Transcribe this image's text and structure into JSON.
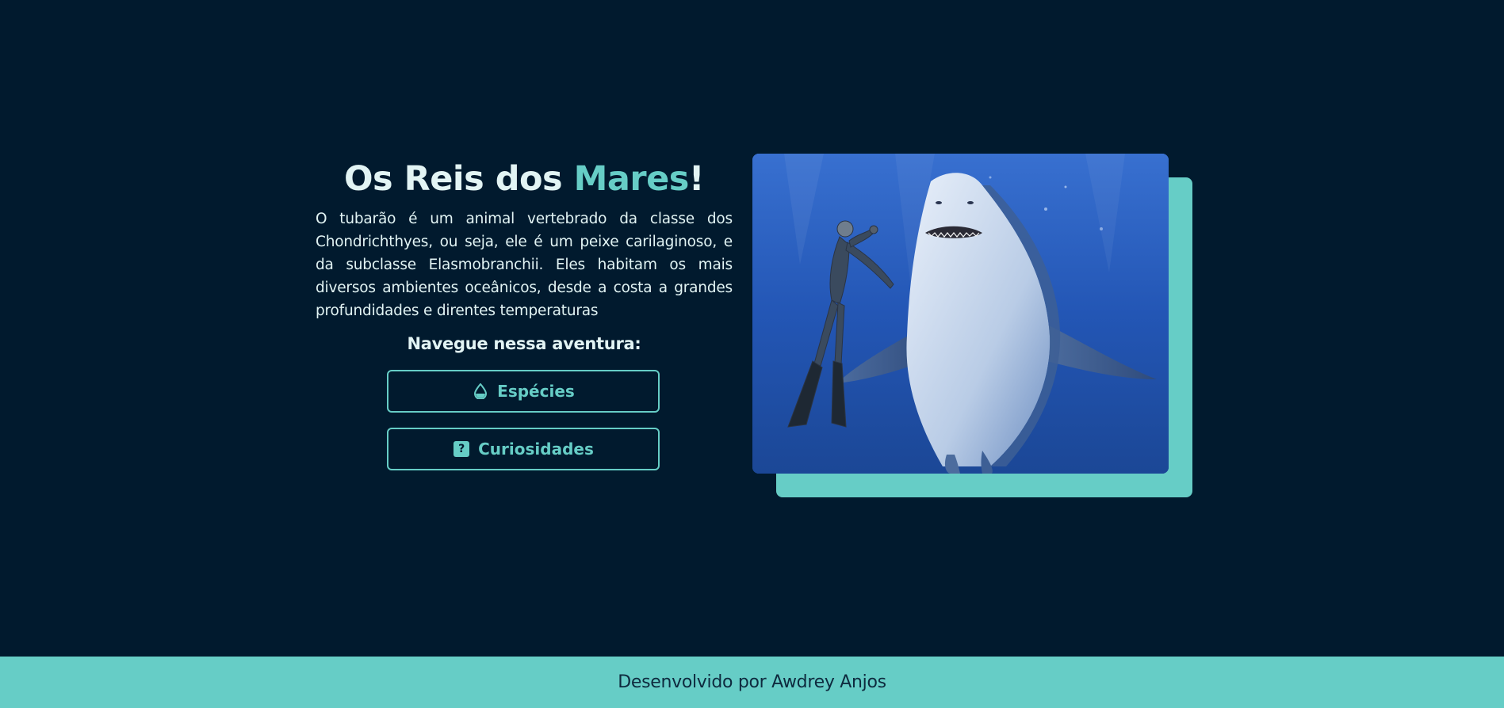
{
  "hero": {
    "title_prefix": "Os Reis dos ",
    "title_accent": "Mares",
    "title_suffix": "!",
    "description": "O tubarão é um animal vertebrado da classe dos Chondrichthyes, ou seja, ele é um peixe carilaginoso, e da subclasse Elasmobranchii. Eles habitam os mais diversos ambientes oceânicos, desde a costa a grandes profundidades e direntes temperaturas",
    "nav_heading": "Navegue nessa aventura:",
    "buttons": [
      {
        "label": "Espécies",
        "icon": "water-drop-icon"
      },
      {
        "label": "Curiosidades",
        "icon": "question-square-icon"
      }
    ],
    "image": {
      "subject": "great-white-shark-with-diver"
    }
  },
  "footer": {
    "text": "Desenvolvido por Awdrey Anjos"
  },
  "colors": {
    "background": "#011A2E",
    "accent": "#66CDC6",
    "text": "#E2F4F4",
    "footer_text": "#0E2A3E"
  }
}
